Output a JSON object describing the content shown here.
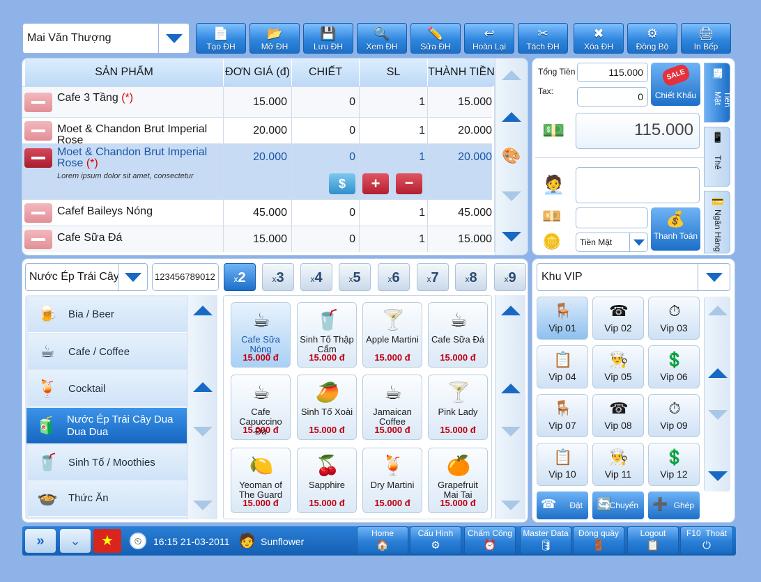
{
  "top": {
    "user": "Mai Văn Thượng",
    "buttons": [
      {
        "label": "Tạo ĐH",
        "icon": "new-order-icon"
      },
      {
        "label": "Mở ĐH",
        "icon": "open-order-icon"
      },
      {
        "label": "Lưu ĐH",
        "icon": "save-icon"
      },
      {
        "label": "Xem ĐH",
        "icon": "view-order-icon"
      },
      {
        "label": "Sửa ĐH",
        "icon": "edit-icon"
      },
      {
        "label": "Hoàn Lại",
        "icon": "return-icon"
      },
      {
        "label": "Tách ĐH",
        "icon": "split-icon"
      },
      {
        "label": "Xóa ĐH",
        "icon": "delete-icon"
      },
      {
        "label": "Đồng Bộ",
        "icon": "sync-icon"
      },
      {
        "label": "In Bếp",
        "icon": "printer-icon"
      }
    ]
  },
  "order": {
    "headers": [
      "SẢN PHẨM",
      "ĐƠN GIÁ (đ)",
      "CHIẾT KHẤU",
      "SL",
      "THÀNH TIỀN"
    ],
    "rows": [
      {
        "name": "Cafe 3 Tầng",
        "mark": "(*)",
        "price": "15.000",
        "discount": "0",
        "qty": "1",
        "total": "15.000"
      },
      {
        "name": "Moet & Chandon Brut Imperial Rose",
        "mark": "",
        "price": "20.000",
        "discount": "0",
        "qty": "1",
        "total": "20.000"
      },
      {
        "name": "Moet & Chandon Brut Imperial Rose",
        "mark": "(*)",
        "note": "Lorem ipsum dolor sit amet, consectetur",
        "price": "20.000",
        "discount": "0",
        "qty": "1",
        "total": "20.000"
      },
      {
        "name": "Cafef Baileys Nóng",
        "mark": "",
        "price": "45.000",
        "discount": "0",
        "qty": "1",
        "total": "45.000"
      },
      {
        "name": "Cafe Sữa Đá",
        "mark": "",
        "price": "15.000",
        "discount": "0",
        "qty": "1",
        "total": "15.000"
      }
    ]
  },
  "payment": {
    "total_label": "Tổng Tiền",
    "total_value": "115.000",
    "tax_label": "Tax:",
    "tax_value": "0",
    "discount_label": "Chiết Khấu",
    "sale_badge": "SALE",
    "grand_total": "115.000",
    "method": "Tiền Mặt",
    "pay_label": "Thanh Toán",
    "tabs": [
      "Tiền Mặt",
      "Thẻ",
      "Ngân Hàng"
    ]
  },
  "menu": {
    "category_select": "Nước Ép Trái Cây",
    "barcode": "123456789012",
    "multipliers": [
      {
        "p": "x",
        "n": "2"
      },
      {
        "p": "x",
        "n": "3"
      },
      {
        "p": "x",
        "n": "4"
      },
      {
        "p": "x",
        "n": "5"
      },
      {
        "p": "x",
        "n": "6"
      },
      {
        "p": "x",
        "n": "7"
      },
      {
        "p": "x",
        "n": "8"
      },
      {
        "p": "x",
        "n": "9"
      }
    ],
    "categories": [
      "Bia / Beer",
      "Cafe / Coffee",
      "Cocktail",
      "Nước Ép Trái Cây Dua Dua Dua",
      "Sinh Tố / Moothies",
      "Thức Ăn"
    ],
    "products": [
      {
        "name": "Cafe Sữa Nóng",
        "price": "15.000 đ"
      },
      {
        "name": "Sinh Tố Thập Cẩm",
        "price": "15.000 đ"
      },
      {
        "name": "Apple Martini",
        "price": "15.000 đ"
      },
      {
        "name": "Cafe Sữa Đá",
        "price": "15.000 đ"
      },
      {
        "name": "Cafe Capuccino Đá",
        "price": "15.000 đ"
      },
      {
        "name": "Sinh Tố Xoài",
        "price": "15.000 đ"
      },
      {
        "name": "Jamaican Coffee",
        "price": "15.000 đ"
      },
      {
        "name": "Pink Lady",
        "price": "15.000 đ"
      },
      {
        "name": "Yeoman of The Guard",
        "price": "15.000 đ"
      },
      {
        "name": "Sapphire",
        "price": "15.000 đ"
      },
      {
        "name": "Dry Martini",
        "price": "15.000 đ"
      },
      {
        "name": "Grapefruit Mai Tai",
        "price": "15.000 đ"
      }
    ]
  },
  "tables": {
    "area": "Khu VIP",
    "items": [
      "Vip 01",
      "Vip 02",
      "Vip 03",
      "Vip 04",
      "Vip 05",
      "Vip 06",
      "Vip 07",
      "Vip 08",
      "Vip 09",
      "Vip 10",
      "Vip 11",
      "Vip 12"
    ],
    "actions": [
      "Đặt",
      "Chuyển",
      "Ghép"
    ]
  },
  "status": {
    "time": "16:15 21-03-2011",
    "user": "Sunflower",
    "nav": [
      {
        "label": "Home",
        "icon": "home-icon"
      },
      {
        "label": "Cấu Hình",
        "icon": "config-icon"
      },
      {
        "label": "Chấm Công",
        "icon": "clock-icon"
      },
      {
        "label": "Master Data",
        "icon": "database-icon"
      },
      {
        "label": "Đóng quầy",
        "icon": "close-counter-icon"
      },
      {
        "label": "Logout",
        "icon": "logout-icon"
      },
      {
        "label": "Thoát",
        "key": "F10",
        "icon": "power-icon"
      }
    ]
  },
  "colors": {
    "accent": "#2f86dd",
    "price_red": "#c00010",
    "background": "#8db3e8"
  }
}
